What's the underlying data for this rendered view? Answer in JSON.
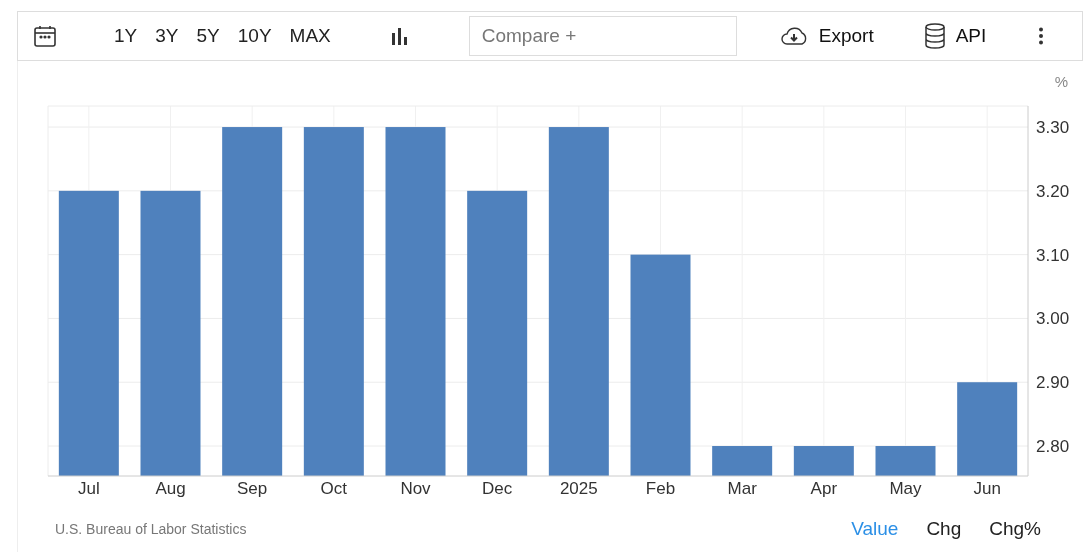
{
  "toolbar": {
    "ranges": [
      {
        "label": "1Y",
        "selected": false
      },
      {
        "label": "3Y",
        "selected": false
      },
      {
        "label": "5Y",
        "selected": false
      },
      {
        "label": "10Y",
        "selected": false
      },
      {
        "label": "MAX",
        "selected": false
      }
    ],
    "compare": {
      "placeholder": "Compare +"
    },
    "export": "Export",
    "api": "API"
  },
  "chart": {
    "chart_data": {
      "type": "bar",
      "ylabel": "%",
      "categories": [
        "Jul",
        "Aug",
        "Sep",
        "Oct",
        "Nov",
        "Dec",
        "2025",
        "Feb",
        "Mar",
        "Apr",
        "May",
        "Jun"
      ],
      "values": [
        3.2,
        3.2,
        3.3,
        3.3,
        3.3,
        3.2,
        3.3,
        3.1,
        2.8,
        2.8,
        2.8,
        2.9
      ],
      "grid": true,
      "ylim": [
        2.753,
        3.333
      ],
      "yticks": [
        {
          "value": 2.8,
          "label": "2.80"
        },
        {
          "value": 2.9,
          "label": "2.90"
        },
        {
          "value": 3.0,
          "label": "3.00"
        },
        {
          "value": 3.1,
          "label": "3.10"
        },
        {
          "value": 3.2,
          "label": "3.20"
        },
        {
          "value": 3.3,
          "label": "3.30"
        }
      ]
    }
  },
  "footer": {
    "source": "U.S. Bureau of Labor Statistics",
    "modes": [
      {
        "label": "Value",
        "selected": true
      },
      {
        "label": "Chg",
        "selected": false
      },
      {
        "label": "Chg%",
        "selected": false
      }
    ]
  }
}
